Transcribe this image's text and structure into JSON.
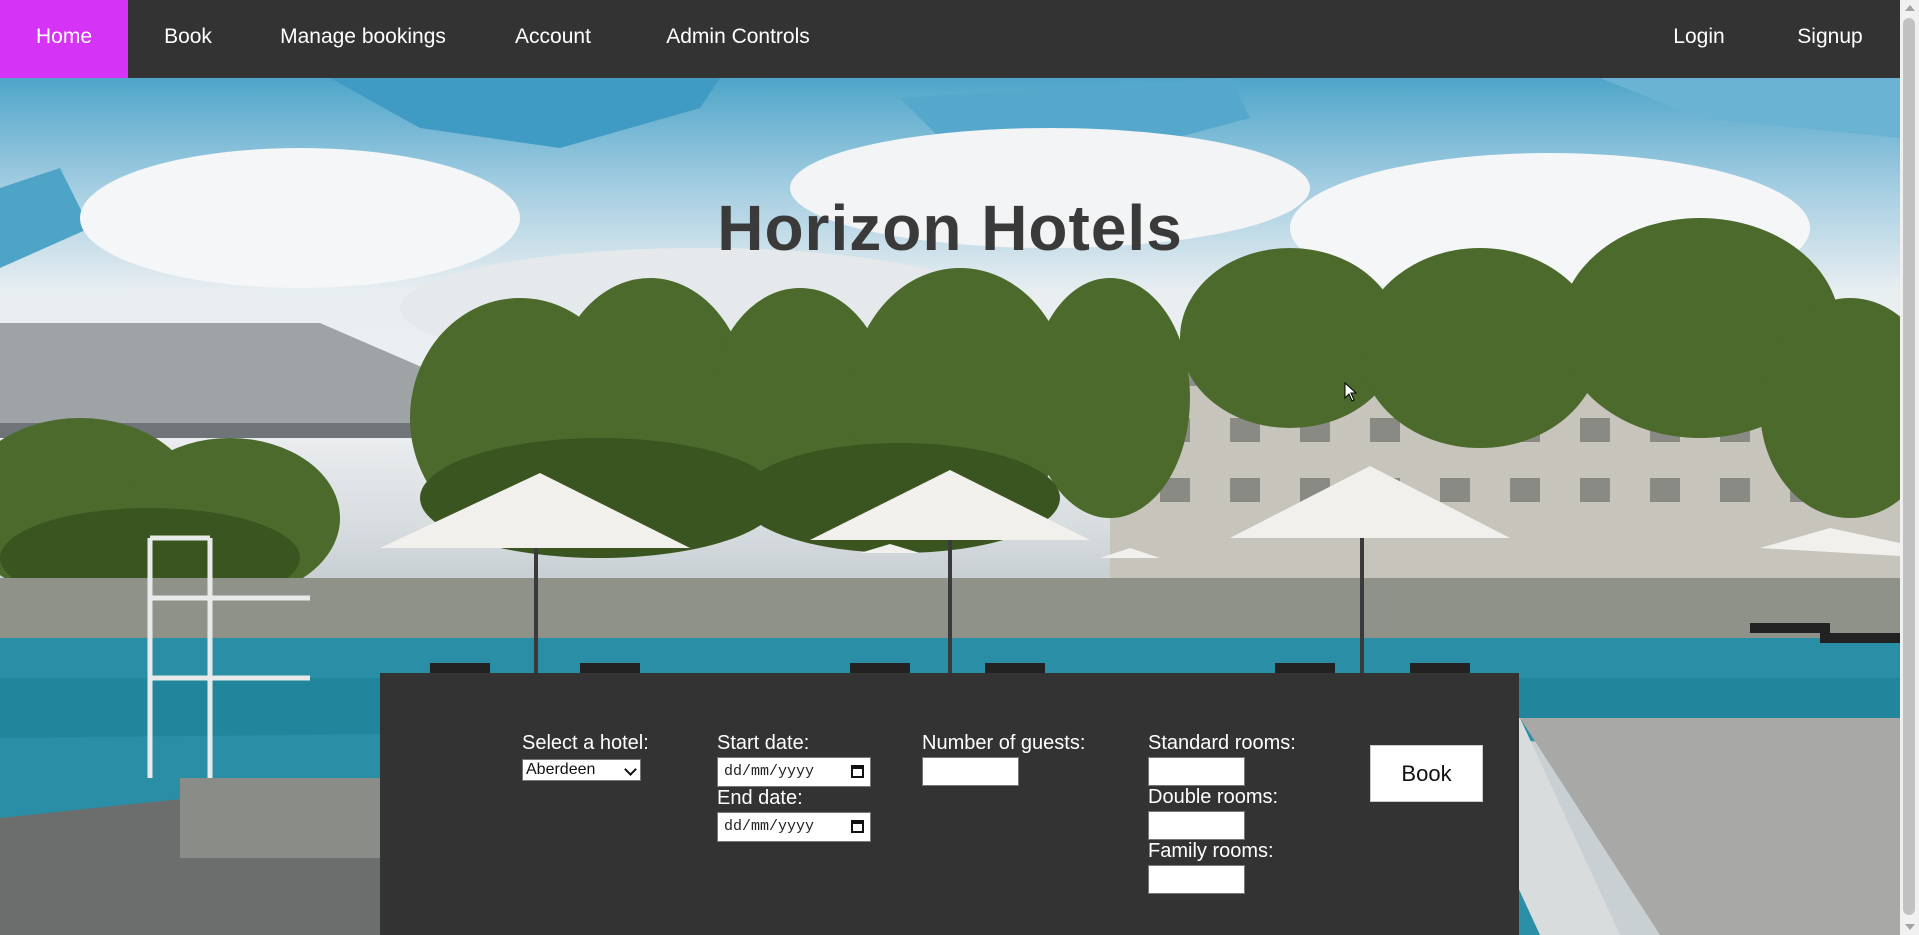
{
  "nav": {
    "home": "Home",
    "book": "Book",
    "manage_bookings": "Manage bookings",
    "account": "Account",
    "admin_controls": "Admin Controls",
    "login": "Login",
    "signup": "Signup"
  },
  "hero": {
    "title": "Horizon Hotels"
  },
  "booking": {
    "hotel_label": "Select a hotel:",
    "hotel_selected": "Aberdeen",
    "start_date_label": "Start date:",
    "start_date_placeholder": "dd/mm/yyyy",
    "end_date_label": "End date:",
    "end_date_placeholder": "dd/mm/yyyy",
    "guests_label": "Number of guests:",
    "standard_label": "Standard rooms:",
    "double_label": "Double rooms:",
    "family_label": "Family rooms:",
    "book_button": "Book"
  },
  "colors": {
    "nav_bg": "#333333",
    "nav_active": "#d534f6",
    "panel_bg": "#333333",
    "title_color": "#3a3a3a"
  },
  "icons": {
    "calendar": "calendar-icon",
    "dropdown": "chevron-down-icon",
    "cursor": "mouse-cursor-icon"
  }
}
